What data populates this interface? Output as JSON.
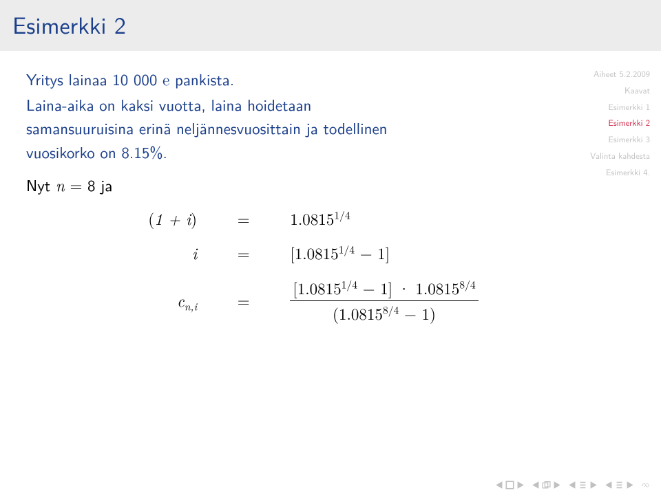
{
  "title": "Esimerkki 2",
  "sidebar": {
    "items": [
      {
        "label": "Aiheet 5.2.2009",
        "active": false
      },
      {
        "label": "Kaavat",
        "active": false
      },
      {
        "label": "Esimerkki 1",
        "active": false
      },
      {
        "label": "Esimerkki 2",
        "active": true
      },
      {
        "label": "Esimerkki 3",
        "active": false
      },
      {
        "label": "Valinta kahdesta",
        "active": false
      },
      {
        "label": "Esimerkki 4.",
        "active": false
      }
    ]
  },
  "body": {
    "line1_pre": "Yritys lainaa 10 000 ",
    "loan_amount": "10 000",
    "euro": "e",
    "line1_post": " pankista.",
    "line2": "Laina-aika on kaksi vuotta, laina hoidetaan samansuuruisina erinä neljännesvuosittain ja todellinen vuosikorko on 8.15%.",
    "rate": "8.15%",
    "n_intro_pre": "Nyt ",
    "n_var": "n",
    "n_intro_mid": " = 8 ja",
    "n_value": "8",
    "equations": {
      "row1": {
        "lhs": "(1 + i)",
        "rhs_base": "1.0815",
        "rhs_exp": "1/4"
      },
      "row2": {
        "lhs": "i",
        "rhs_pre": "[1.0815",
        "rhs_exp": "1/4",
        "rhs_post": " − 1]"
      },
      "row3": {
        "lhs_c": "c",
        "lhs_sub": "n,i",
        "num_pre": "[1.0815",
        "num_exp1": "1/4",
        "num_mid": " − 1] · 1.0815",
        "num_exp2": "8/4",
        "den_pre": "(1.0815",
        "den_exp": "8/4",
        "den_post": " − 1)"
      }
    }
  }
}
